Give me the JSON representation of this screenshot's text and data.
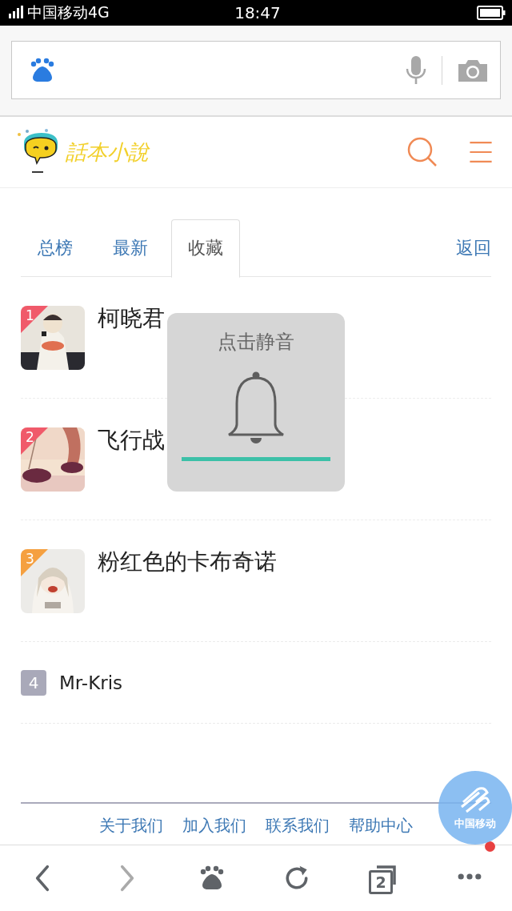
{
  "status_bar": {
    "carrier": "中国移动4G",
    "time": "18:47"
  },
  "site": {
    "logo_text": "話本小說"
  },
  "tabs": [
    {
      "label": "总榜",
      "selected": false
    },
    {
      "label": "最新",
      "selected": false
    },
    {
      "label": "收藏",
      "selected": true
    }
  ],
  "back_link": "返回",
  "items": [
    {
      "rank": "1",
      "title": "柯晓君",
      "color": "#f05a6a",
      "kind": "picture"
    },
    {
      "rank": "2",
      "title": "飞行战",
      "color": "#f05a6a",
      "kind": "picture"
    },
    {
      "rank": "3",
      "title": "粉红色的卡布奇诺",
      "color": "#f5a040",
      "kind": "picture"
    },
    {
      "rank": "4",
      "title": "Mr-Kris",
      "color": "#a9a9b9",
      "kind": "plain"
    }
  ],
  "footer_links": [
    "关于我们",
    "加入我们",
    "联系我们",
    "帮助中心"
  ],
  "toast": {
    "title": "点击静音"
  },
  "floating_badge": {
    "label": "中国移动"
  },
  "toolbar": {
    "tabs_count": "2",
    "notification": true
  }
}
